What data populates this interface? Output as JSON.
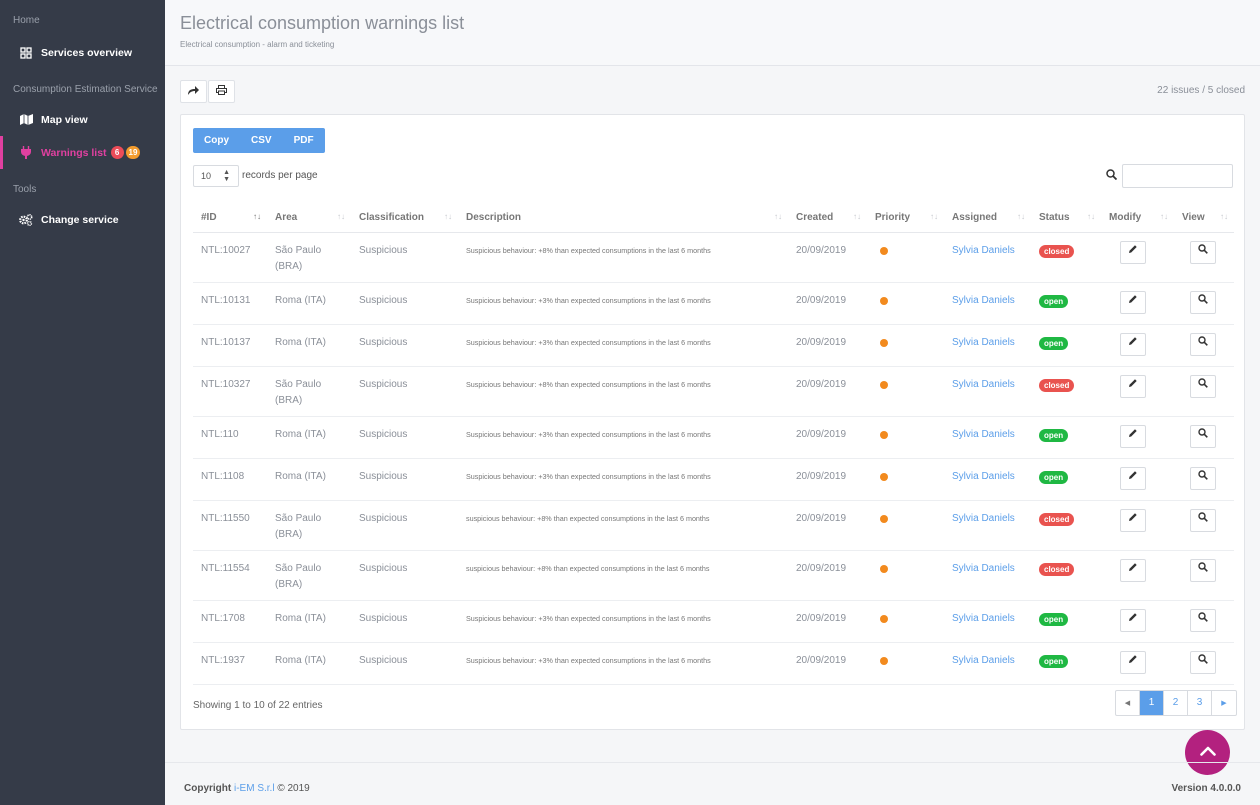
{
  "sidebar": {
    "headings": [
      "Home",
      "Consumption Estimation Service",
      "Tools"
    ],
    "items": [
      {
        "label": "Services overview",
        "icon": "grid-icon"
      },
      {
        "label": "Map view",
        "icon": "map-icon"
      },
      {
        "label": "Warnings list",
        "icon": "plug-icon",
        "badges": [
          "6",
          "19"
        ]
      },
      {
        "label": "Change service",
        "icon": "cogs-icon"
      }
    ]
  },
  "header": {
    "title": "Electrical consumption warnings list",
    "subtitle": "Electrical consumption - alarm and ticketing"
  },
  "toolbar": {
    "summary": "22 issues / 5 closed"
  },
  "exports": [
    "Copy",
    "CSV",
    "PDF"
  ],
  "records": {
    "value": "10",
    "label": "records per page"
  },
  "table": {
    "columns": [
      "#ID",
      "Area",
      "Classification",
      "Description",
      "Created",
      "Priority",
      "Assigned",
      "Status",
      "Modify",
      "View"
    ],
    "rows": [
      {
        "id": "NTL:10027",
        "area": "São Paulo (BRA)",
        "classification": "Suspicious",
        "description": "Suspicious behaviour: +8% than expected consumptions in the last 6 months",
        "created": "20/09/2019",
        "assigned": "Sylvia Daniels",
        "status": "closed"
      },
      {
        "id": "NTL:10131",
        "area": "Roma (ITA)",
        "classification": "Suspicious",
        "description": "Suspicious behaviour: +3% than expected consumptions in the last 6 months",
        "created": "20/09/2019",
        "assigned": "Sylvia Daniels",
        "status": "open"
      },
      {
        "id": "NTL:10137",
        "area": "Roma (ITA)",
        "classification": "Suspicious",
        "description": "Suspicious behaviour: +3% than expected consumptions in the last 6 months",
        "created": "20/09/2019",
        "assigned": "Sylvia Daniels",
        "status": "open"
      },
      {
        "id": "NTL:10327",
        "area": "São Paulo (BRA)",
        "classification": "Suspicious",
        "description": "Suspicious behaviour: +8% than expected consumptions in the last 6 months",
        "created": "20/09/2019",
        "assigned": "Sylvia Daniels",
        "status": "closed"
      },
      {
        "id": "NTL:110",
        "area": "Roma (ITA)",
        "classification": "Suspicious",
        "description": "Suspicious behaviour: +3% than expected consumptions in the last 6 months",
        "created": "20/09/2019",
        "assigned": "Sylvia Daniels",
        "status": "open"
      },
      {
        "id": "NTL:1108",
        "area": "Roma (ITA)",
        "classification": "Suspicious",
        "description": "Suspicious behaviour: +3% than expected consumptions in the last 6 months",
        "created": "20/09/2019",
        "assigned": "Sylvia Daniels",
        "status": "open"
      },
      {
        "id": "NTL:11550",
        "area": "São Paulo (BRA)",
        "classification": "Suspicious",
        "description": "suspicious behaviour: +8% than expected consumptions in the last 6 months",
        "created": "20/09/2019",
        "assigned": "Sylvia Daniels",
        "status": "closed"
      },
      {
        "id": "NTL:11554",
        "area": "São Paulo (BRA)",
        "classification": "Suspicious",
        "description": "suspicious behaviour: +8% than expected consumptions in the last 6 months",
        "created": "20/09/2019",
        "assigned": "Sylvia Daniels",
        "status": "closed"
      },
      {
        "id": "NTL:1708",
        "area": "Roma (ITA)",
        "classification": "Suspicious",
        "description": "Suspicious behaviour: +3% than expected consumptions in the last 6 months",
        "created": "20/09/2019",
        "assigned": "Sylvia Daniels",
        "status": "open"
      },
      {
        "id": "NTL:1937",
        "area": "Roma (ITA)",
        "classification": "Suspicious",
        "description": "Suspicious behaviour: +3% than expected consumptions in the last 6 months",
        "created": "20/09/2019",
        "assigned": "Sylvia Daniels",
        "status": "open"
      }
    ]
  },
  "footer_info": {
    "showing": "Showing 1 to 10 of 22 entries",
    "pages": [
      "1",
      "2",
      "3"
    ],
    "copyright_prefix": "Copyright",
    "company": "i-EM S.r.l",
    "copyright_suffix": "© 2019",
    "version": "Version 4.0.0.0"
  },
  "colors": {
    "sidebar_bg": "#353b48",
    "accent": "#5b9ee9",
    "active_nav": "#e040a0",
    "status_open": "#1fb843",
    "status_closed": "#e9534f",
    "priority": "#f28a1e"
  }
}
